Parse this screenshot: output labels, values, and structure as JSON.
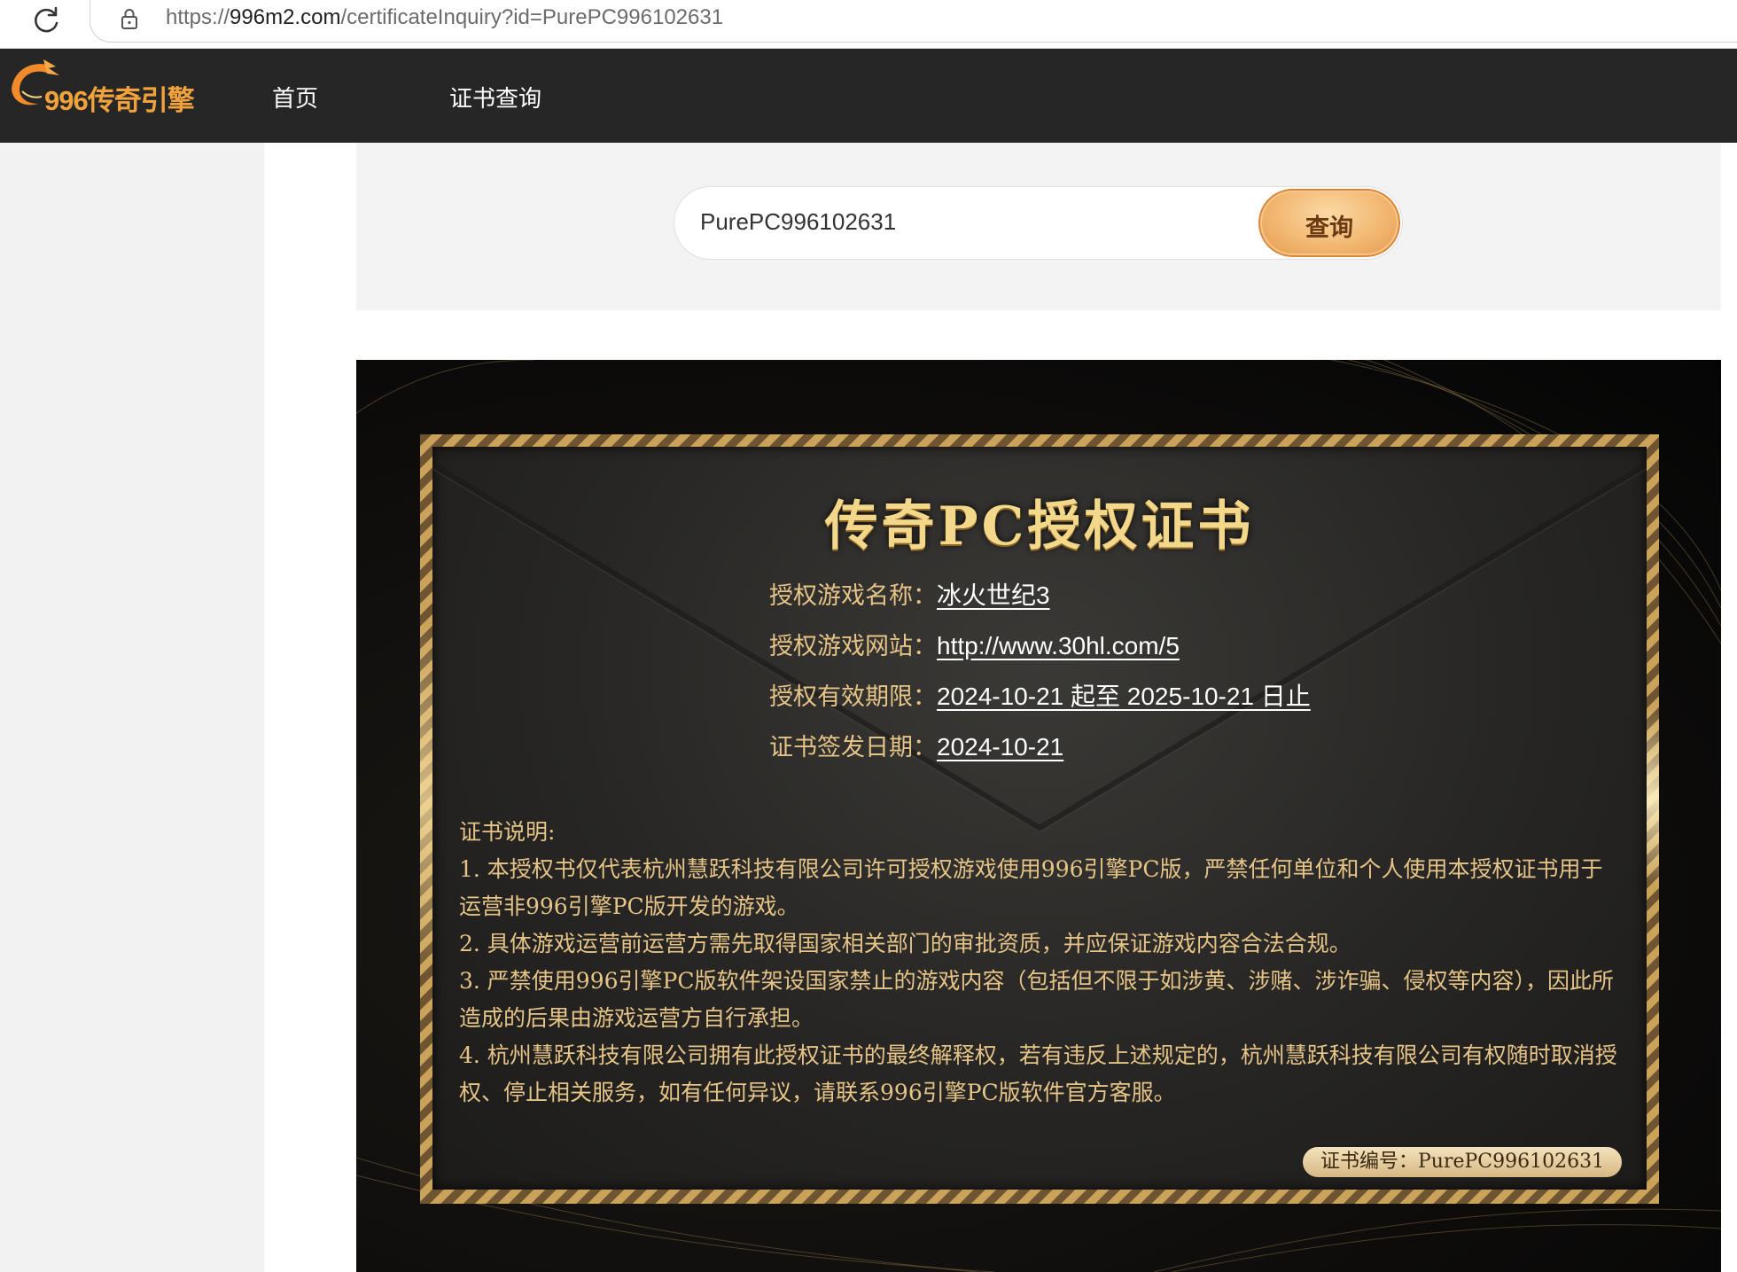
{
  "browser": {
    "url_host": "996m2.com",
    "url_prefix": "https://",
    "url_path": "/certificateInquiry?id=PurePC996102631",
    "icons": [
      "reload-icon",
      "lock-icon"
    ]
  },
  "nav": {
    "logo_text": "996传奇引擎",
    "items": [
      {
        "label": "首页"
      },
      {
        "label": "证书查询"
      }
    ]
  },
  "search": {
    "value": "PurePC996102631",
    "button_label": "查询",
    "accent": "#f2b873"
  },
  "certificate": {
    "title": "传奇PC授权证书",
    "fields": [
      {
        "label": "授权游戏名称：",
        "value": "冰火世纪3"
      },
      {
        "label": "授权游戏网站：",
        "value": "http://www.30hl.com/5"
      },
      {
        "label": "授权有效期限：",
        "value": "2024-10-21 起至 2025-10-21 日止"
      },
      {
        "label": "证书签发日期：",
        "value": "2024-10-21"
      }
    ],
    "notes_heading": "证书说明:",
    "notes": [
      "1.  本授权书仅代表杭州慧跃科技有限公司许可授权游戏使用996引擎PC版，严禁任何单位和个人使用本授权证书用于运营非996引擎PC版开发的游戏。",
      "2.  具体游戏运营前运营方需先取得国家相关部门的审批资质，并应保证游戏内容合法合规。",
      "3.  严禁使用996引擎PC版软件架设国家禁止的游戏内容（包括但不限于如涉黄、涉赌、涉诈骗、侵权等内容），因此所造成的后果由游戏运营方自行承担。",
      "4.  杭州慧跃科技有限公司拥有此授权证书的最终解释权，若有违反上述规定的，杭州慧跃科技有限公司有权随时取消授权、停止相关服务，如有任何异议，请联系996引擎PC版软件官方客服。"
    ],
    "number_label": "证书编号：PurePC996102631",
    "colors": {
      "gold": "#e6c488",
      "title_gold": "#f3d78a",
      "panel": "#272624"
    }
  }
}
